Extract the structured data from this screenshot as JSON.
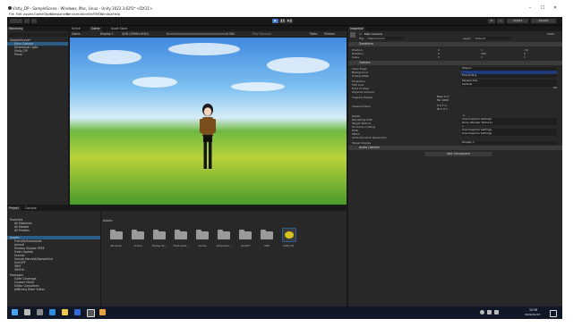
{
  "window": {
    "title": "Vistly_DP - SampleScene - Windows, Mac, Linux - Unity 2022.3.62f1* <DX11>",
    "controls": [
      "–",
      "☐",
      "✕"
    ]
  },
  "menu": [
    "File",
    "Edit",
    "Assets",
    "GameObject",
    "Component",
    "Services",
    "VoiceBr",
    "VRMO",
    "Window",
    "Help"
  ],
  "toolbar": {
    "layers": "Layers",
    "layout": "Layout"
  },
  "hierarchy": {
    "tab": "Hierarchy",
    "items": [
      {
        "label": "SampleScene*",
        "indent": 0,
        "selected": false
      },
      {
        "label": "Main Camera",
        "indent": 1,
        "selected": true
      },
      {
        "label": "Directional Light",
        "indent": 1,
        "selected": false
      },
      {
        "label": "Vistly_DP",
        "indent": 1,
        "selected": false
      },
      {
        "label": "Plane",
        "indent": 1,
        "selected": false
      }
    ]
  },
  "scene_tabs": [
    "Scene",
    "Game",
    "Asset Store"
  ],
  "game_bar": {
    "display": "Display 1",
    "resolution": "QHD (2560×1440)",
    "scale_label": "Scale",
    "scale_value": "0.28x",
    "play_focused": "Play Focused",
    "stats": "Stats",
    "gizmos": "Gizmos"
  },
  "inspector": {
    "tab": "Inspector",
    "object_name": "Main Camera",
    "static_label": "Static",
    "tag_label": "Tag",
    "tag_value": "MainCamera",
    "layer_label": "Layer",
    "layer_value": "Default",
    "transform": {
      "header": "Transform",
      "rows": [
        {
          "label": "Position",
          "values": [
            "0",
            "1",
            "-10"
          ]
        },
        {
          "label": "Rotation",
          "values": [
            "0",
            "180",
            "0"
          ]
        },
        {
          "label": "Scale",
          "values": [
            "1",
            "1",
            "1"
          ]
        }
      ]
    },
    "camera": {
      "header": "Camera",
      "rows": [
        {
          "label": "Clear Flags",
          "value": "Skybox"
        },
        {
          "label": "Background",
          "value": ""
        },
        {
          "label": "Culling Mask",
          "value": "Everything"
        },
        {
          "label": "Projection",
          "value": "Perspective"
        },
        {
          "label": "FOV Axis",
          "value": "Vertical"
        },
        {
          "label": "Field of View",
          "value": "60"
        },
        {
          "label": "Physical Camera",
          "value": ""
        },
        {
          "label": "Clipping Planes",
          "value": "Near 0.3"
        },
        {
          "label": "",
          "value": "Far 1000"
        },
        {
          "label": "Viewport Rect",
          "value": "X 0   Y 0"
        },
        {
          "label": "",
          "value": "W 1   H 1"
        },
        {
          "label": "Depth",
          "value": "-1"
        },
        {
          "label": "Rendering Path",
          "value": "Use Graphics Settings"
        },
        {
          "label": "Target Texture",
          "value": "None (Render Texture)"
        },
        {
          "label": "Occlusion Culling",
          "value": "✓"
        },
        {
          "label": "HDR",
          "value": "Use Graphics Settings"
        },
        {
          "label": "MSAA",
          "value": "Use Graphics Settings"
        },
        {
          "label": "Allow Dynamic Resolution",
          "value": ""
        },
        {
          "label": "Target Display",
          "value": "Display 1"
        }
      ]
    },
    "audio_listener": "Audio Listener",
    "add_component": "Add Component"
  },
  "project": {
    "tabs": [
      "Project",
      "Console"
    ],
    "favorites_header": "Favorites",
    "favorites": [
      "All Materials",
      "All Models",
      "All Prefabs"
    ],
    "assets_header": "Assets",
    "asset_tree": [
      "FriendlyHumanoids",
      "Animal",
      "Fantasy Skybox FREE",
      "Fresh Update",
      "Scenes",
      "Sunset Harvest/SampleSce",
      "UniGLTF",
      "VRM",
      "VRM10"
    ],
    "packages_header": "Packages",
    "packages": [
      "Code Coverage",
      "Custom NUnit",
      "Editor Coroutines",
      "JetBrains Rider Editor"
    ],
    "breadcrumb": "Assets",
    "grid_items": [
      "_TerrainSa...",
      "Animal",
      "Fantasy Sk...",
      "Fresh Upda...",
      "Scenes",
      "SampleSce...",
      "UniGLTF",
      "VRM",
      "Vistly_DP"
    ]
  },
  "taskbar": {
    "clock": "10:26",
    "date": "2024/10/13"
  },
  "colors": {
    "accent": "#2c5d87",
    "play": "#3f72c1",
    "panel": "#282828",
    "background": "#191919"
  }
}
